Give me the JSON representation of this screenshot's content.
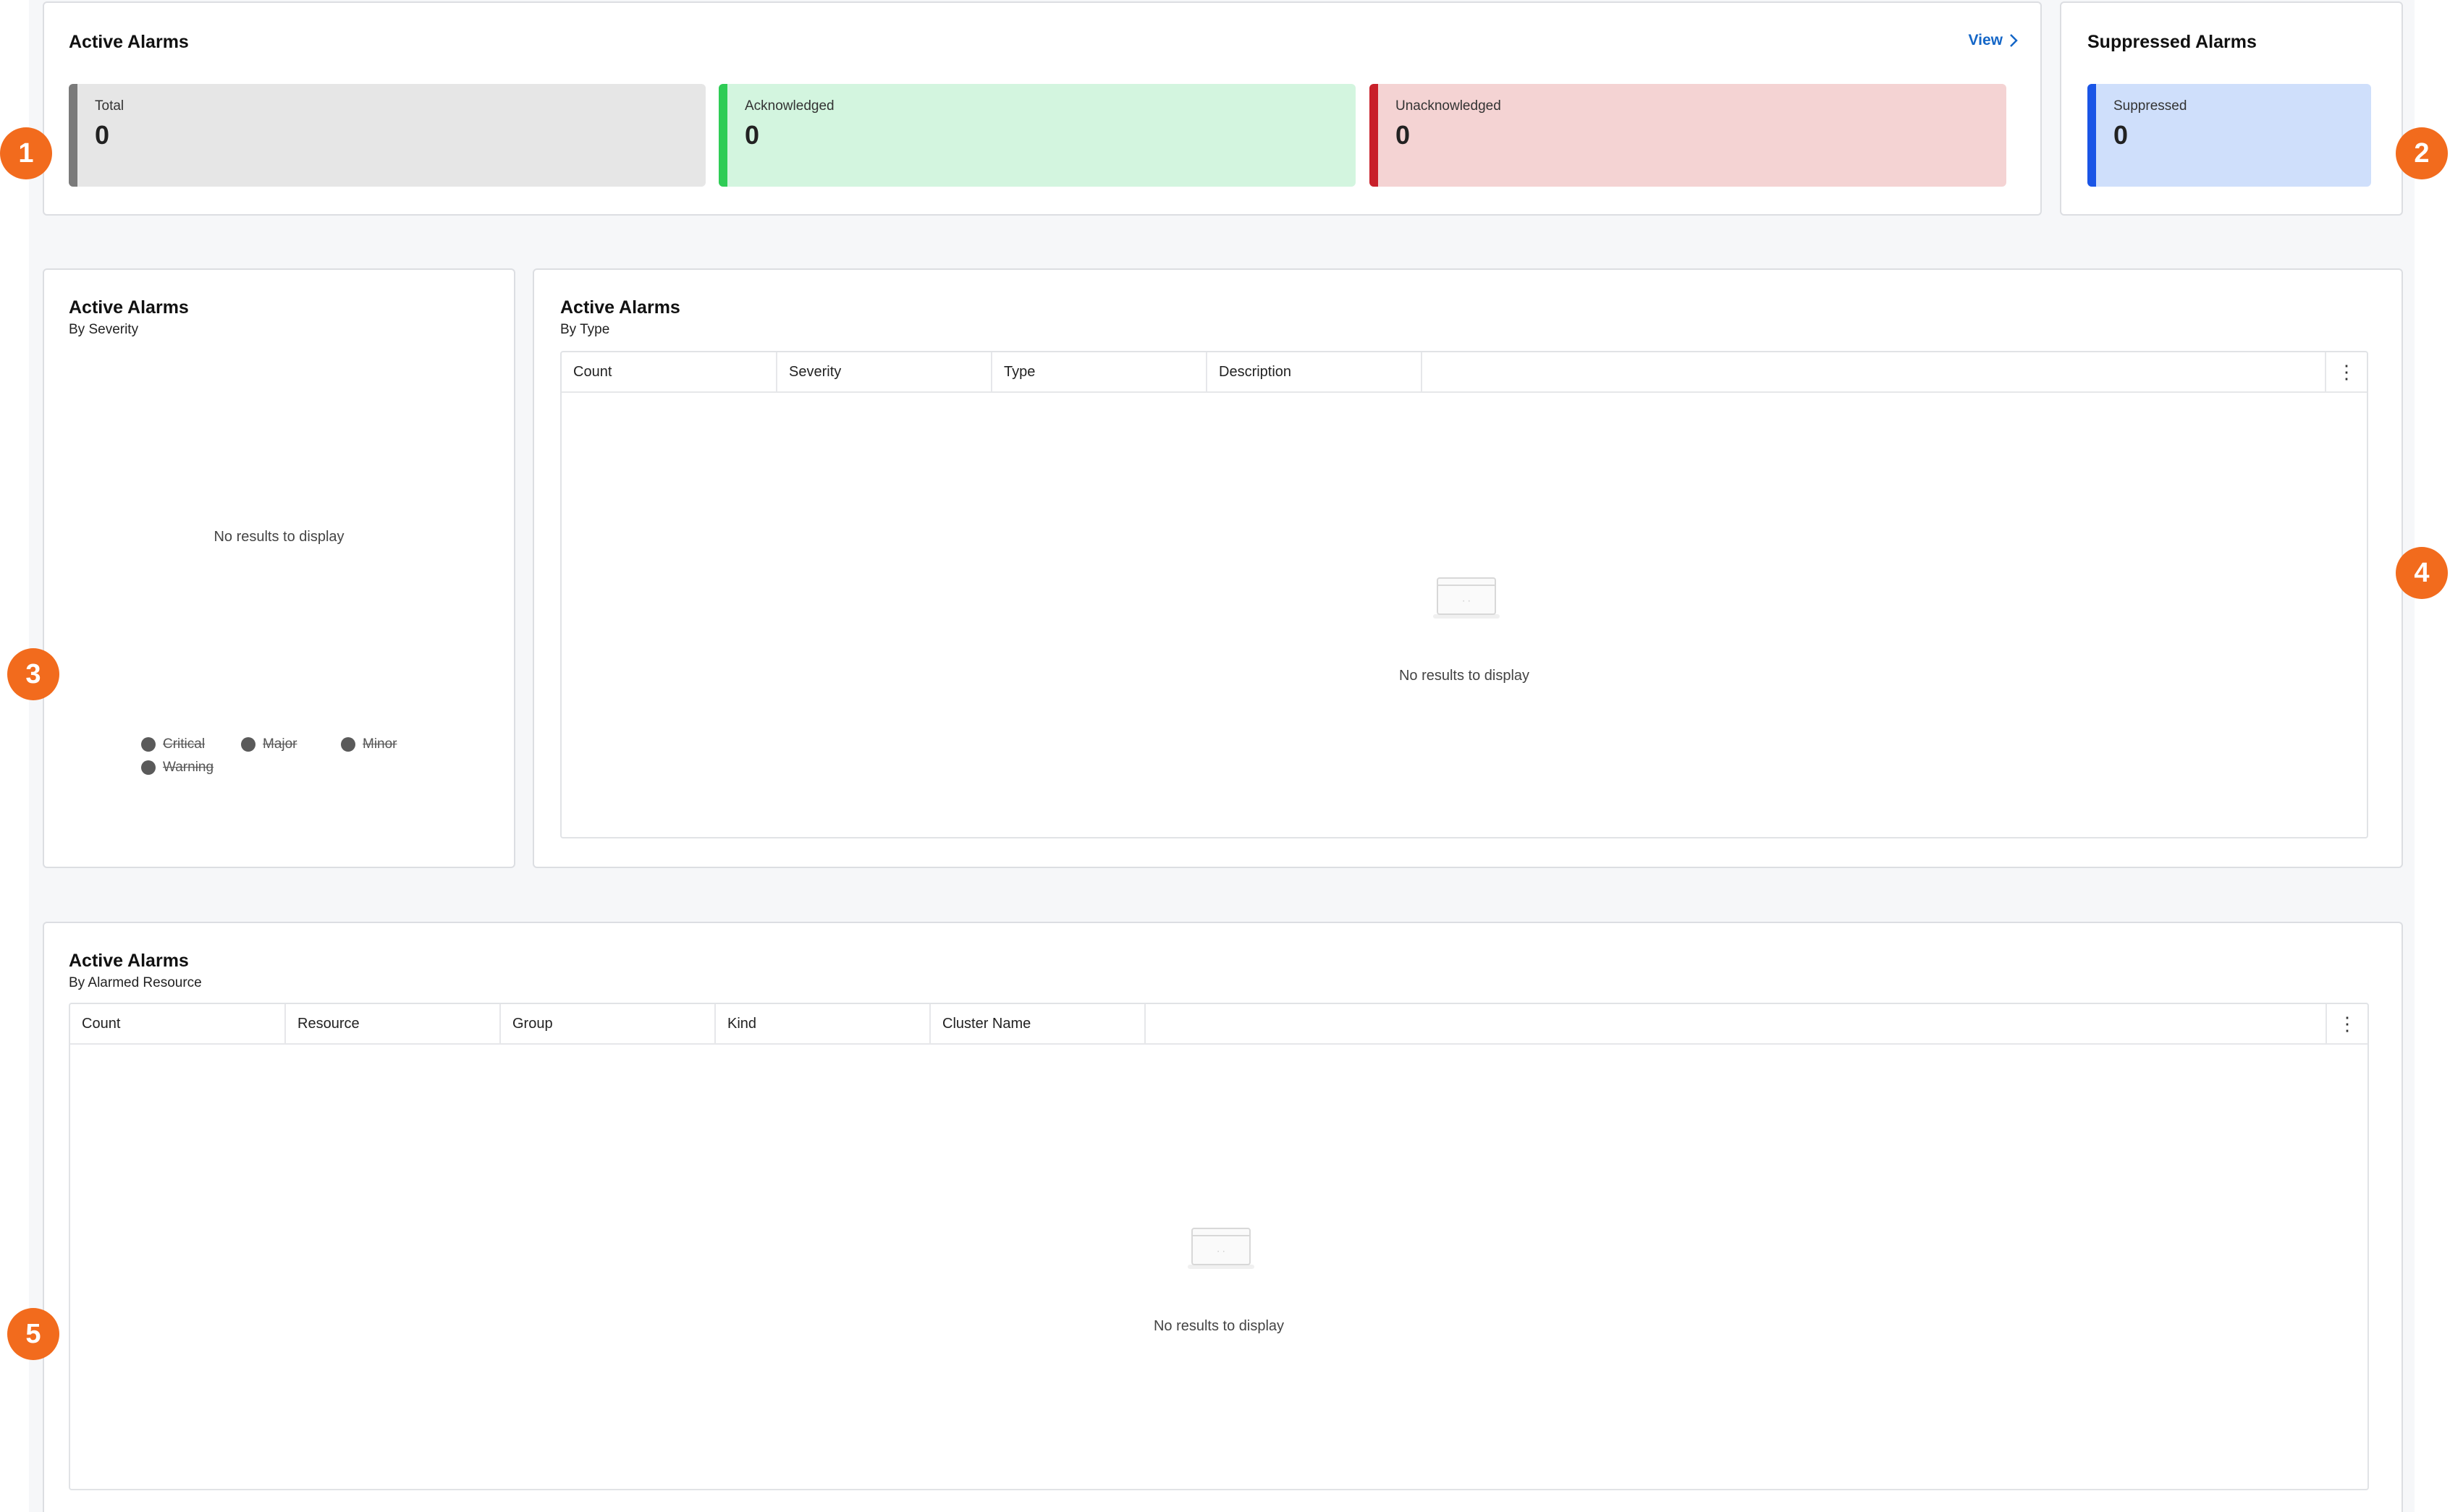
{
  "colors": {
    "total_bar": "#7a7a7a",
    "total_bg": "#e6e6e6",
    "ack_bar": "#2ecc55",
    "ack_bg": "#d3f5df",
    "unack_bar": "#c8202a",
    "unack_bg": "#f4d3d3",
    "suppressed_bar": "#1a55e6",
    "suppressed_bg": "#cfdffb",
    "link": "#1466c7",
    "badge": "#f26b1d"
  },
  "summary": {
    "title": "Active Alarms",
    "view_link": "View",
    "view_icon": "chevron-right-icon",
    "stats": [
      {
        "label": "Total",
        "value": "0"
      },
      {
        "label": "Acknowledged",
        "value": "0"
      },
      {
        "label": "Unacknowledged",
        "value": "0"
      }
    ]
  },
  "suppressed": {
    "title": "Suppressed Alarms",
    "stat": {
      "label": "Suppressed",
      "value": "0"
    }
  },
  "severity": {
    "title": "Active Alarms",
    "subtitle": "By Severity",
    "empty": "No results to display",
    "legend": [
      "Critical",
      "Major",
      "Minor",
      "Warning"
    ]
  },
  "by_type": {
    "title": "Active Alarms",
    "subtitle": "By Type",
    "columns": [
      "Count",
      "Severity",
      "Type",
      "Description"
    ],
    "empty": "No results to display"
  },
  "by_resource": {
    "title": "Active Alarms",
    "subtitle": "By Alarmed Resource",
    "columns": [
      "Count",
      "Resource",
      "Group",
      "Kind",
      "Cluster Name"
    ],
    "empty": "No results to display"
  },
  "callouts": [
    "1",
    "2",
    "3",
    "4",
    "5"
  ]
}
